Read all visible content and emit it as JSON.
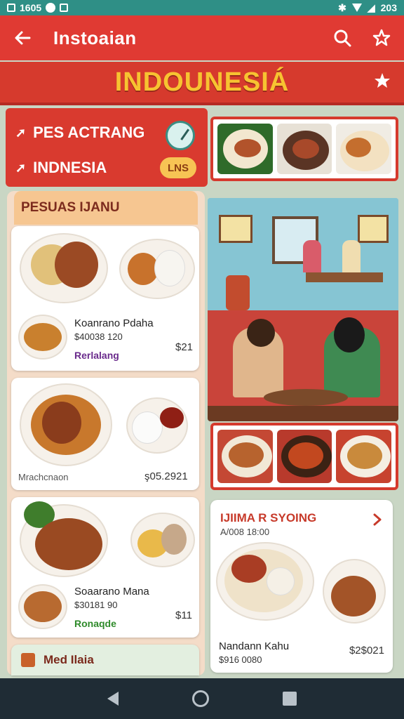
{
  "status_bar": {
    "time": "1605",
    "right_text": "203"
  },
  "app_bar": {
    "title": "Instoaian"
  },
  "banner": {
    "title": "INDOUNESIÁ"
  },
  "nav": {
    "items": [
      {
        "label": "PES ACTRANG"
      },
      {
        "label": "INDNESIA"
      }
    ],
    "badge": "LNS"
  },
  "menu": {
    "header": "PESUAS IJANU",
    "cards": [
      {
        "title": "Koanrano Pdaha",
        "sub": "$40038 120",
        "tag": "Rerlalang",
        "tag_color": "#6a2b8c",
        "price": "$21"
      },
      {
        "title": "",
        "sub": "",
        "tag": "",
        "tag_color": "#333333",
        "price": "",
        "footer_left": "Mrachcnaon",
        "footer_right": "ş05.2921"
      },
      {
        "title": "Soaarano Mana",
        "sub": "$30181 90",
        "tag": "Ronaqde",
        "tag_color": "#2f8b2b",
        "price": "$11"
      }
    ],
    "footer_item": "Med Ilaia"
  },
  "detail": {
    "title": "IJIIMA R SYOING",
    "sub": "A/008 18:00",
    "item_name": "Nandann Kahu",
    "item_sub": "$916 0080",
    "price": "$2$021"
  },
  "colors": {
    "primary": "#e03a33",
    "banner_text": "#f7c331",
    "status": "#2f8f86"
  }
}
